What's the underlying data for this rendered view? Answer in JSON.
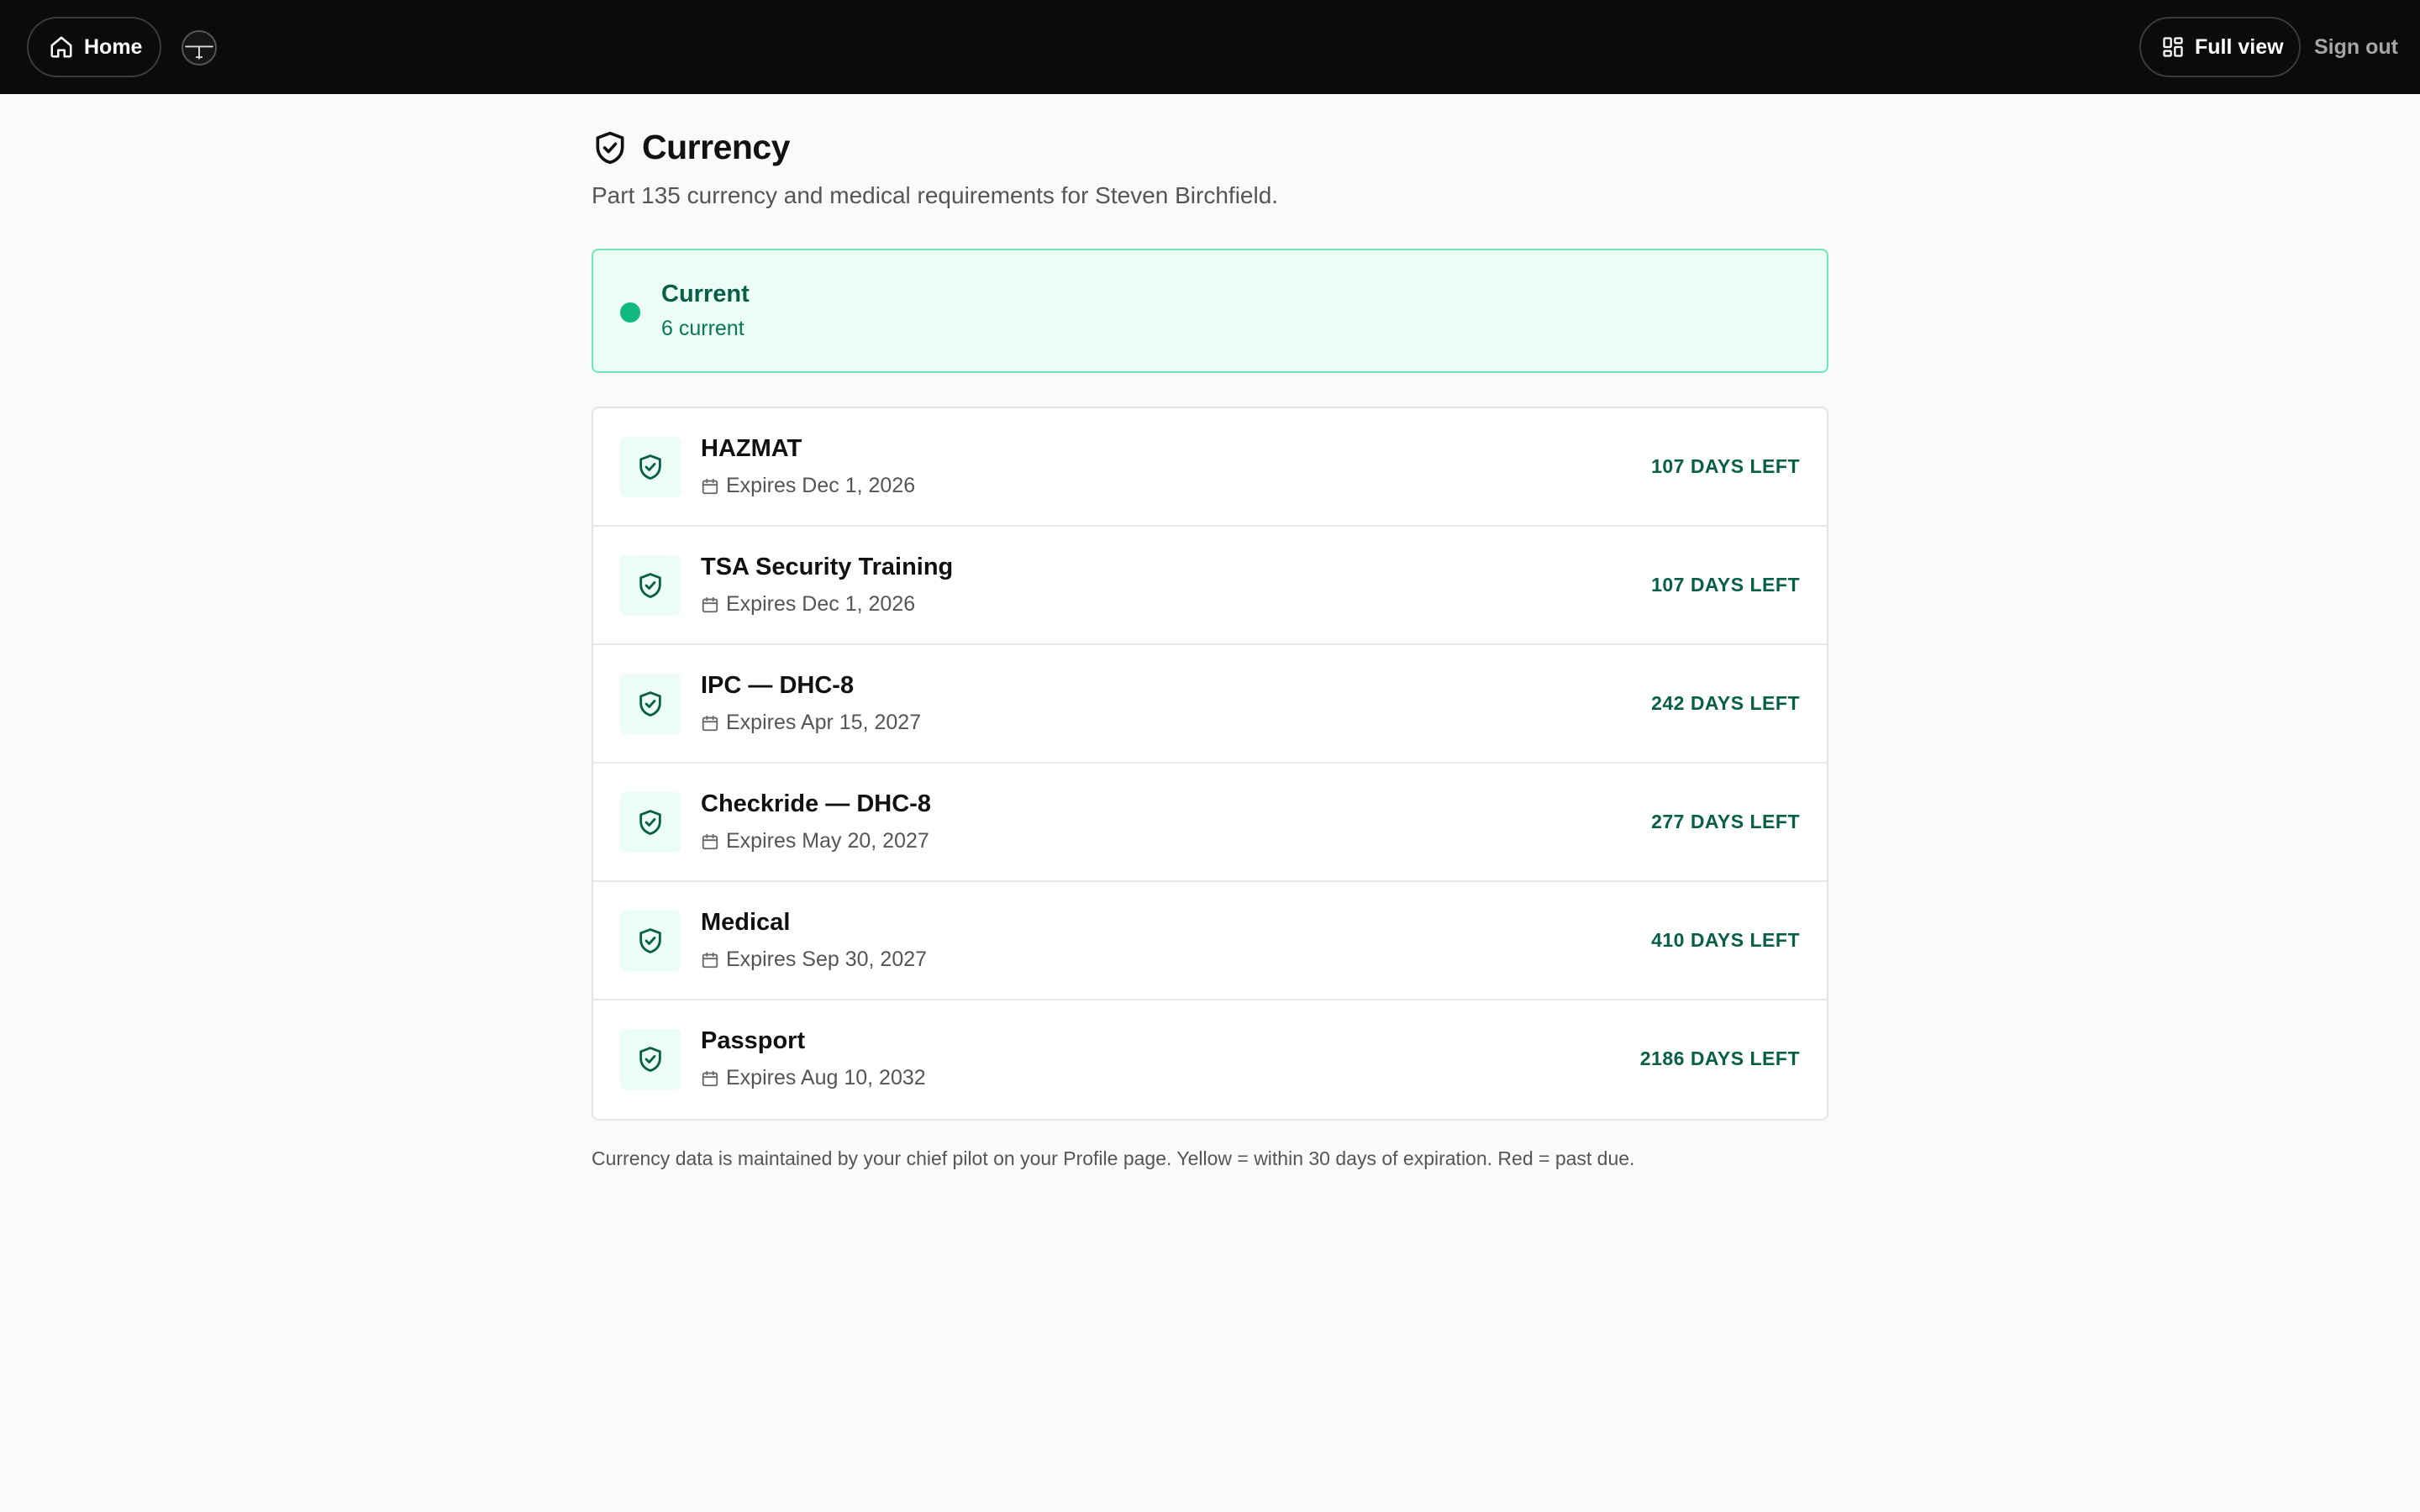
{
  "topbar": {
    "home_label": "Home",
    "home_icon": "home-icon",
    "logo_icon": "airplane-logo-icon",
    "fullview_label": "Full view",
    "fullview_icon": "grid-icon",
    "signout_label": "Sign out"
  },
  "header": {
    "title": "Currency",
    "icon": "shield-check-icon",
    "subtitle": "Part 135 currency and medical requirements for Steven Birchfield."
  },
  "status": {
    "title": "Current",
    "count": "6 current",
    "color": "#10b981"
  },
  "items": [
    {
      "name": "HAZMAT",
      "expiry": "Expires Dec 1, 2026",
      "days_left": "107 DAYS LEFT"
    },
    {
      "name": "TSA Security Training",
      "expiry": "Expires Dec 1, 2026",
      "days_left": "107 DAYS LEFT"
    },
    {
      "name": "IPC — DHC-8",
      "expiry": "Expires Apr 15, 2027",
      "days_left": "242 DAYS LEFT"
    },
    {
      "name": "Checkride — DHC-8",
      "expiry": "Expires May 20, 2027",
      "days_left": "277 DAYS LEFT"
    },
    {
      "name": "Medical",
      "expiry": "Expires Sep 30, 2027",
      "days_left": "410 DAYS LEFT"
    },
    {
      "name": "Passport",
      "expiry": "Expires Aug 10, 2032",
      "days_left": "2186 DAYS LEFT"
    }
  ],
  "footnote": "Currency data is maintained by your chief pilot on your Profile page. Yellow = within 30 days of expiration. Red = past due.",
  "colors": {
    "accent": "#065f46",
    "banner_bg": "#ecfdf5",
    "banner_border": "#6ee7b7",
    "topbar_bg": "#0b0b0b"
  }
}
